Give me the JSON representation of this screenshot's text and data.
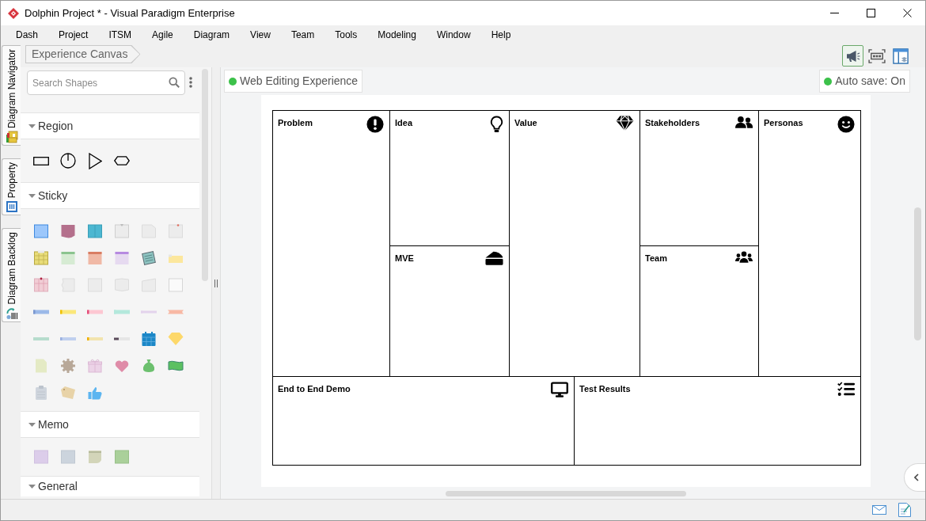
{
  "window": {
    "title": "Dolphin Project * - Visual Paradigm Enterprise"
  },
  "menu": [
    "Dash",
    "Project",
    "ITSM",
    "Agile",
    "Diagram",
    "View",
    "Team",
    "Tools",
    "Modeling",
    "Window",
    "Help"
  ],
  "side_tabs": [
    {
      "label": "Diagram Navigator"
    },
    {
      "label": "Property"
    },
    {
      "label": "Diagram Backlog"
    }
  ],
  "breadcrumb": "Experience Canvas",
  "toolbar": [
    {
      "selected": true
    },
    {
      "selected": false
    },
    {
      "selected": false
    }
  ],
  "shape_panel": {
    "search": {
      "placeholder": "Search Shapes"
    },
    "sections": [
      {
        "title": "Region",
        "expanded": true
      },
      {
        "title": "Sticky",
        "expanded": true
      },
      {
        "title": "Memo",
        "expanded": true
      },
      {
        "title": "General",
        "expanded": true
      }
    ]
  },
  "diagram": {
    "title": "Web Editing Experience",
    "autosave": "Auto save: On",
    "columns": [
      {
        "cells": [
          {
            "label": "Problem"
          }
        ]
      },
      {
        "cells": [
          {
            "label": "Idea"
          },
          {
            "label": "MVE"
          }
        ]
      },
      {
        "cells": [
          {
            "label": "Value"
          }
        ]
      },
      {
        "cells": [
          {
            "label": "Stakeholders"
          },
          {
            "label": "Team"
          }
        ]
      },
      {
        "cells": [
          {
            "label": "Personas"
          }
        ]
      }
    ],
    "bottom_row": [
      {
        "label": "End to End Demo"
      },
      {
        "label": "Test Results"
      }
    ]
  }
}
